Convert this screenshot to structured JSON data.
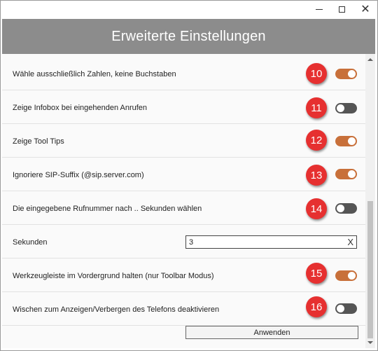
{
  "window": {
    "controls": {
      "minimize": "minimize-icon",
      "maximize": "maximize-icon",
      "close": "close-icon"
    }
  },
  "header": {
    "title": "Erweiterte Einstellungen"
  },
  "colors": {
    "header_bg": "#8c8c8c",
    "toggle_on": "#c8703a",
    "toggle_off": "#555555",
    "badge": "#e63030"
  },
  "settings": [
    {
      "label": "Wähle ausschließlich Zahlen, keine Buchstaben",
      "badge": "10",
      "enabled": true
    },
    {
      "label": "Zeige Infobox bei eingehenden Anrufen",
      "badge": "11",
      "enabled": false
    },
    {
      "label": "Zeige Tool Tips",
      "badge": "12",
      "enabled": true
    },
    {
      "label": "Ignoriere SIP-Suffix (@sip.server.com)",
      "badge": "13",
      "enabled": true
    },
    {
      "label": "Die eingegebene Rufnummer nach .. Sekunden wählen",
      "badge": "14",
      "enabled": false
    },
    {
      "label": "Werkzeugleiste im Vordergrund halten (nur Toolbar Modus)",
      "badge": "15",
      "enabled": true
    },
    {
      "label": "Wischen zum Anzeigen/Verbergen des Telefons deaktivieren",
      "badge": "16",
      "enabled": false
    }
  ],
  "seconds": {
    "label": "Sekunden",
    "value": "3",
    "clear_glyph": "X"
  },
  "apply_button": {
    "label": "Anwenden"
  }
}
